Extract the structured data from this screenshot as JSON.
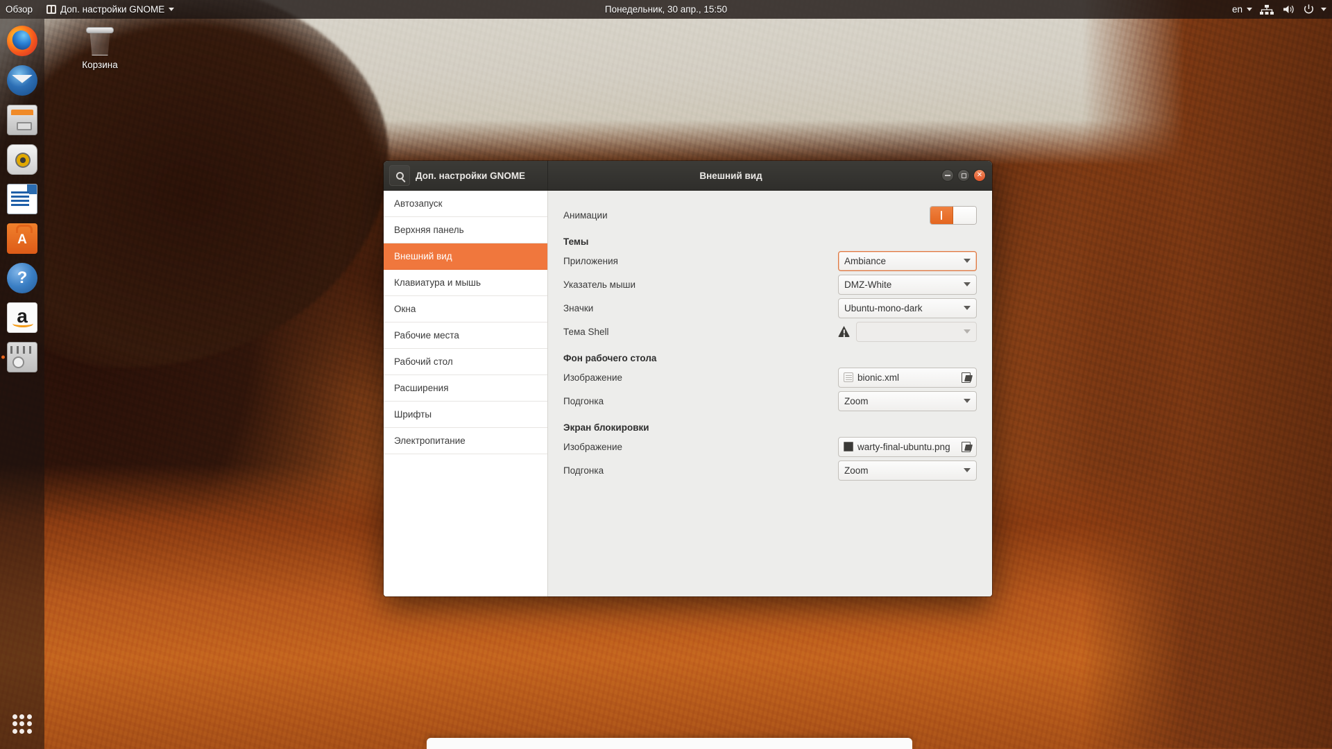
{
  "top_panel": {
    "overview_label": "Обзор",
    "app_icon": "gnome-tweaks-icon",
    "app_menu_label": "Доп. настройки GNOME",
    "app_menu_caret": "chevron-down-icon",
    "clock": "Понедельник, 30 апр., 15:50",
    "keyboard_layout": "en",
    "layout_caret": "chevron-down-icon",
    "network_icon": "network-icon",
    "volume_icon": "volume-icon",
    "power_icon": "power-icon",
    "system_caret": "chevron-down-icon"
  },
  "dock": {
    "items": [
      {
        "name": "firefox",
        "tooltip": "Firefox",
        "running": false
      },
      {
        "name": "thunderbird",
        "tooltip": "Thunderbird",
        "running": false
      },
      {
        "name": "files",
        "tooltip": "Files",
        "running": false
      },
      {
        "name": "rhythmbox",
        "tooltip": "Rhythmbox",
        "running": false
      },
      {
        "name": "libreoffice-writer",
        "tooltip": "LibreOffice Writer",
        "running": false
      },
      {
        "name": "ubuntu-software",
        "tooltip": "Ubuntu Software",
        "running": false
      },
      {
        "name": "help",
        "tooltip": "Help",
        "running": false
      },
      {
        "name": "amazon",
        "tooltip": "Amazon",
        "running": false
      },
      {
        "name": "gnome-tweaks",
        "tooltip": "Доп. настройки GNOME",
        "running": true
      }
    ],
    "show_apps_label": "show-applications"
  },
  "desktop": {
    "trash_label": "Корзина"
  },
  "window": {
    "search_icon": "search-icon",
    "app_title": "Доп. настройки GNOME",
    "page_title": "Внешний вид",
    "minimize_label": "minimize",
    "maximize_label": "maximize",
    "close_label": "close"
  },
  "sidebar": {
    "items": [
      {
        "label": "Автозапуск",
        "selected": false
      },
      {
        "label": "Верхняя панель",
        "selected": false
      },
      {
        "label": "Внешний вид",
        "selected": true
      },
      {
        "label": "Клавиатура и мышь",
        "selected": false
      },
      {
        "label": "Окна",
        "selected": false
      },
      {
        "label": "Рабочие места",
        "selected": false
      },
      {
        "label": "Рабочий стол",
        "selected": false
      },
      {
        "label": "Расширения",
        "selected": false
      },
      {
        "label": "Шрифты",
        "selected": false
      },
      {
        "label": "Электропитание",
        "selected": false
      }
    ]
  },
  "content": {
    "animations_label": "Анимации",
    "animations_state": "on",
    "themes_heading": "Темы",
    "applications_label": "Приложения",
    "applications_value": "Ambiance",
    "cursor_label": "Указатель мыши",
    "cursor_value": "DMZ-White",
    "icons_label": "Значки",
    "icons_value": "Ubuntu-mono-dark",
    "shell_label": "Тема Shell",
    "shell_value": "",
    "shell_warning_icon": "warning-icon",
    "background_heading": "Фон рабочего стола",
    "background_image_label": "Изображение",
    "background_image_value": "bionic.xml",
    "background_adjust_label": "Подгонка",
    "background_adjust_value": "Zoom",
    "lock_heading": "Экран блокировки",
    "lock_image_label": "Изображение",
    "lock_image_value": "warty-final-ubuntu.png",
    "lock_adjust_label": "Подгонка",
    "lock_adjust_value": "Zoom",
    "open_icon": "open-folder-icon"
  },
  "colors": {
    "accent": "#f0773d",
    "panel": "#1c1412",
    "titlebar": "#3c3b37",
    "window_bg": "#ededeb",
    "sidebar_bg": "#ffffff",
    "close_button": "#e2562a"
  }
}
